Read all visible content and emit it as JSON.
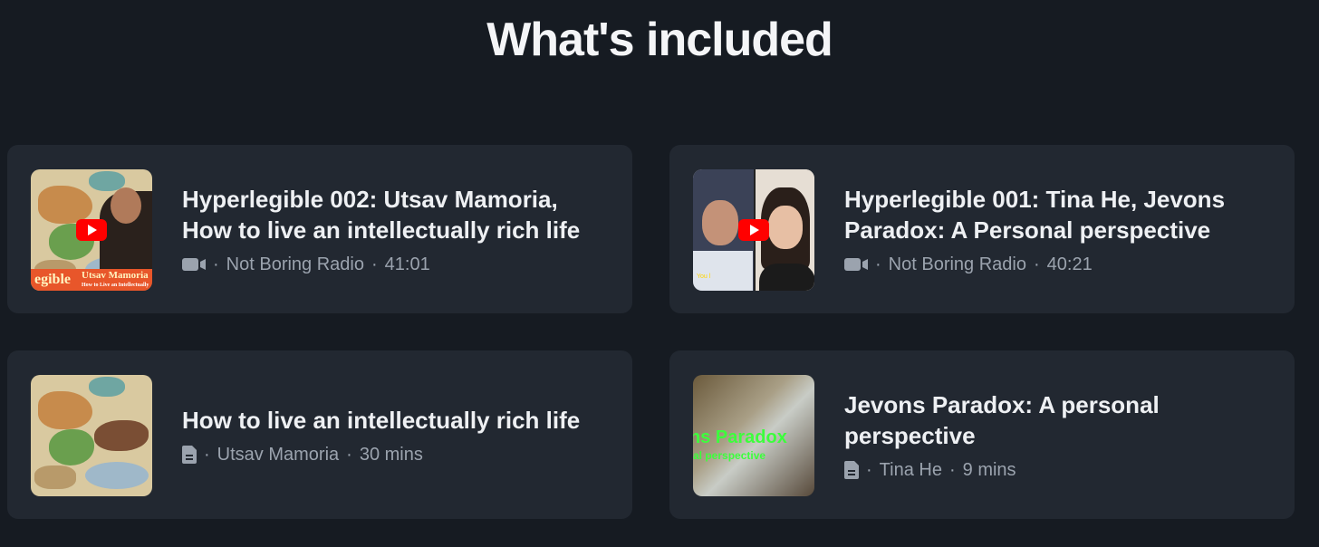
{
  "heading": "What's included",
  "cards": [
    {
      "title": "Hyperlegible 002: Utsav Mamoria, How to live an intellectually rich life",
      "icon": "video-icon",
      "author": "Not Boring Radio",
      "length": "41:01",
      "thumb": {
        "banner": "egible",
        "banner_name": "Utsav Mamoria",
        "banner_sub": "How to Live an Intellectually Rich"
      }
    },
    {
      "title": "Hyperlegible 001: Tina He, Jevons Paradox: A Personal perspective",
      "icon": "video-icon",
      "author": "Not Boring Radio",
      "length": "40:21",
      "thumb": {
        "caption": "You l"
      }
    },
    {
      "title": "How to live an intellectually rich life",
      "icon": "document-icon",
      "author": "Utsav Mamoria",
      "length": "30 mins"
    },
    {
      "title": "Jevons Paradox: A personal perspective",
      "icon": "document-icon",
      "author": "Tina He",
      "length": "9 mins",
      "thumb": {
        "line1": "ns Paradox",
        "line2": "al perspective"
      }
    }
  ],
  "separator": "·",
  "colors": {
    "background": "#161b22",
    "card": "#222831",
    "meta": "#9ba3ae",
    "youtube": "#ff0000"
  }
}
